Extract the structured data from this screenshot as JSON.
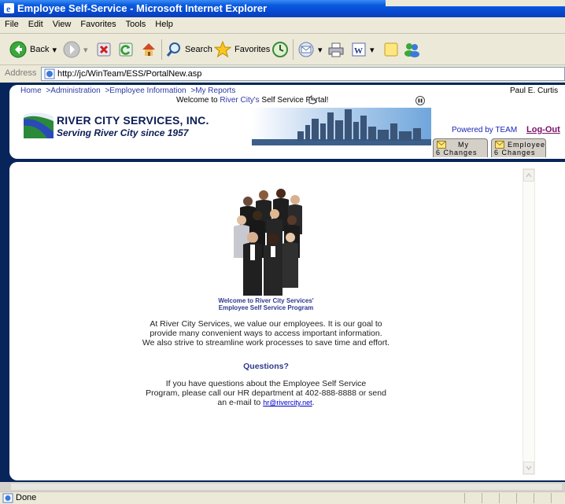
{
  "window": {
    "title": "Employee Self-Service - Microsoft Internet Explorer"
  },
  "menu": [
    "File",
    "Edit",
    "View",
    "Favorites",
    "Tools",
    "Help"
  ],
  "toolbar": {
    "back_label": "Back",
    "search_label": "Search",
    "favorites_label": "Favorites"
  },
  "address": {
    "label": "Address",
    "url": "http://jc/WinTeam/ESS/PortalNew.asp"
  },
  "breadcrumb": [
    ">Administration",
    ">Employee Information",
    ">My Reports"
  ],
  "breadcrumb_home": "Home",
  "header": {
    "user_name": "Paul E. Curtis",
    "welcome_prefix": "Welcome to ",
    "welcome_company": "River City's",
    "welcome_suffix": " Self Service Portal!",
    "company_name": "RIVER CITY SERVICES, INC.",
    "tagline": "Serving River City since 1957",
    "powered_by": "Powered by TEAM",
    "logout": "Log-Out"
  },
  "tabs": [
    {
      "line1": "My",
      "count": "6",
      "line2": "Changes"
    },
    {
      "line1": "Employee",
      "count": "6",
      "line2": "Changes"
    }
  ],
  "main": {
    "heading_line1": "Welcome to River City Services'",
    "heading_line2": "Employee Self Service Program",
    "para1_line1": "At River City Services, we value our employees.  It is our goal to",
    "para1_line2": "provide many convenient ways to access important information.",
    "para1_line3": "We also strive to streamline work processes to save time and effort.",
    "questions": "Questions?",
    "para2_line1": "If you have questions about the Employee Self Service",
    "para2_line2": "Program, please call our HR department at 402-888-8888 or send",
    "para2_line3_prefix": "an e-mail to ",
    "email": "hr@rivercity.net",
    "para2_line3_suffix": "."
  },
  "status": {
    "text": "Done"
  },
  "colors": {
    "frame": "#07255a",
    "link": "#2f39a8",
    "logout": "#7a1068",
    "heading": "#2e3a8c"
  }
}
